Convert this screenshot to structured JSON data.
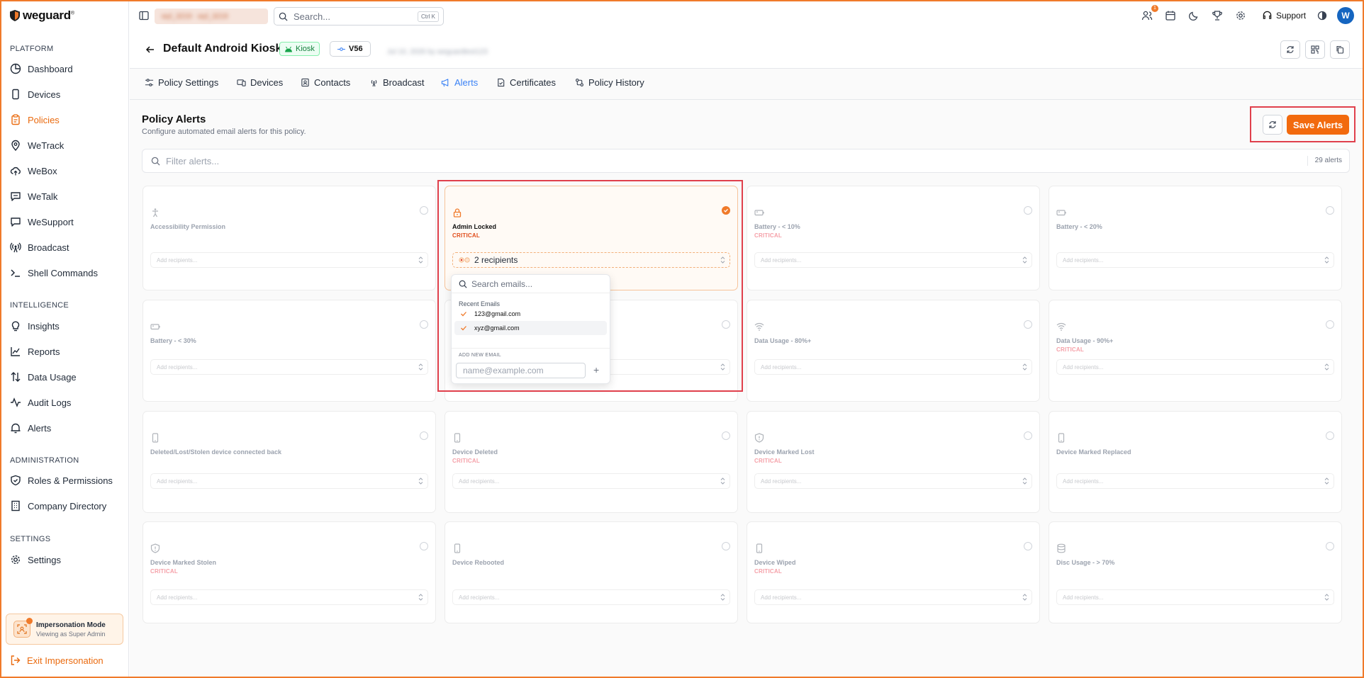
{
  "app": {
    "logo": "weguard",
    "logo_mark": "®"
  },
  "sidebar": {
    "sections": {
      "platform": "PLATFORM",
      "intelligence": "INTELLIGENCE",
      "administration": "ADMINISTRATION",
      "settings": "SETTINGS"
    },
    "platform_items": [
      "Dashboard",
      "Devices",
      "Policies",
      "WeTrack",
      "WeBox",
      "WeTalk",
      "WeSupport",
      "Broadcast",
      "Shell Commands"
    ],
    "intelligence_items": [
      "Insights",
      "Reports",
      "Data Usage",
      "Audit Logs",
      "Alerts"
    ],
    "administration_items": [
      "Roles & Permissions",
      "Company Directory"
    ],
    "settings_items": [
      "Settings"
    ],
    "active": "Policies",
    "impersonation": {
      "title": "Impersonation Mode",
      "subtitle": "Viewing as Super Admin"
    },
    "exit_label": "Exit Impersonation"
  },
  "topbar": {
    "org_blurred": "wyl_3219 · wyl_3219",
    "search_placeholder": "Search...",
    "search_shortcut": "Ctrl K",
    "notification_count": "1",
    "support_label": "Support",
    "avatar_initial": "W"
  },
  "header": {
    "title": "Default Android Kiosk",
    "mode_tag": "Kiosk",
    "version_tag": "V56",
    "meta_blurred": "Jul 10, 2026 by weguardtest123"
  },
  "tabs": [
    "Policy Settings",
    "Devices",
    "Contacts",
    "Broadcast",
    "Alerts",
    "Certificates",
    "Policy History"
  ],
  "active_tab": "Alerts",
  "alerts_page": {
    "title": "Policy Alerts",
    "subtitle": "Configure automated email alerts for this policy.",
    "save_label": "Save Alerts",
    "filter_placeholder": "Filter alerts...",
    "count_label": "29 alerts"
  },
  "recipient_placeholder": "Add recipients...",
  "critical_label": "CRITICAL",
  "alerts": [
    {
      "title": "Accessibility Permission",
      "critical": false,
      "icon": "accessibility-icon",
      "selected": false
    },
    {
      "title": "Admin Locked",
      "critical": true,
      "icon": "lock-icon",
      "selected": true,
      "recipients_label": "2 recipients"
    },
    {
      "title": "Battery - < 10%",
      "critical": true,
      "icon": "battery-icon",
      "selected": false
    },
    {
      "title": "Battery - < 20%",
      "critical": false,
      "icon": "battery-icon",
      "selected": false
    },
    {
      "title": "Battery - < 30%",
      "critical": false,
      "icon": "battery-icon",
      "selected": false
    },
    {
      "title": "",
      "critical": false,
      "icon": "",
      "selected": false
    },
    {
      "title": "Data Usage - 80%+",
      "critical": false,
      "icon": "wifi-icon",
      "selected": false
    },
    {
      "title": "Data Usage - 90%+",
      "critical": true,
      "icon": "wifi-icon",
      "selected": false
    },
    {
      "title": "Deleted/Lost/Stolen device connected back",
      "critical": false,
      "icon": "phone-icon",
      "selected": false
    },
    {
      "title": "Device Deleted",
      "critical": true,
      "icon": "phone-icon",
      "selected": false
    },
    {
      "title": "Device Marked Lost",
      "critical": true,
      "icon": "shield-alert-icon",
      "selected": false
    },
    {
      "title": "Device Marked Replaced",
      "critical": false,
      "icon": "phone-icon",
      "selected": false
    },
    {
      "title": "Device Marked Stolen",
      "critical": true,
      "icon": "shield-alert-icon",
      "selected": false
    },
    {
      "title": "Device Rebooted",
      "critical": false,
      "icon": "phone-icon",
      "selected": false
    },
    {
      "title": "Device Wiped",
      "critical": true,
      "icon": "phone-icon",
      "selected": false
    },
    {
      "title": "Disc Usage - > 70%",
      "critical": false,
      "icon": "database-icon",
      "selected": false
    }
  ],
  "dropdown": {
    "search_placeholder": "Search emails...",
    "recent_heading": "Recent Emails",
    "emails": [
      "123@gmail.com",
      "xyz@gmail.com"
    ],
    "add_heading": "ADD NEW EMAIL",
    "add_placeholder": "name@example.com",
    "add_symbol": "+"
  },
  "colors": {
    "accent": "#f26a0e",
    "critical": "#e04c1a",
    "active_tab": "#3b82f6",
    "highlight": "#e0404c"
  }
}
